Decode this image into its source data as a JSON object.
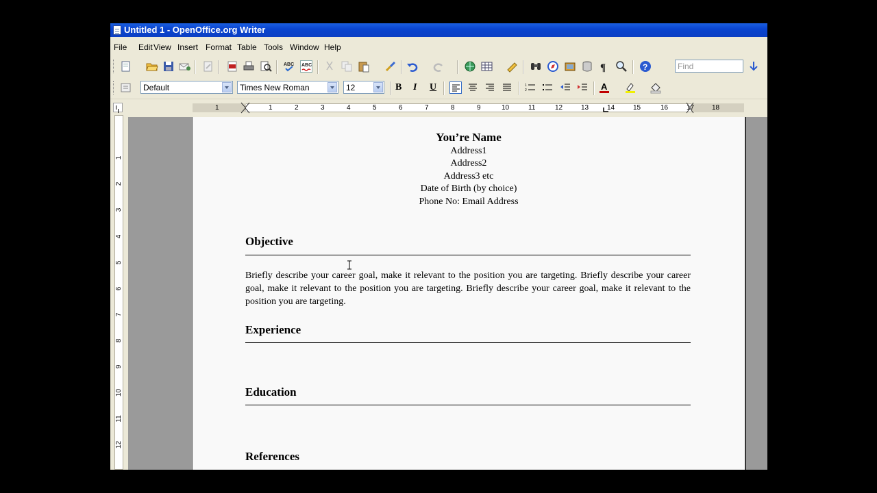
{
  "window": {
    "title": "Untitled 1 - OpenOffice.org Writer"
  },
  "menu": [
    "File",
    "Edit",
    "View",
    "Insert",
    "Format",
    "Table",
    "Tools",
    "Window",
    "Help"
  ],
  "toolbar_standard": {
    "icons": [
      "new-document-icon",
      "open-folder-icon",
      "save-icon",
      "email-icon",
      "edit-file-icon",
      "export-pdf-icon",
      "print-icon",
      "page-preview-icon",
      "spellcheck-icon",
      "autospellcheck-icon",
      "cut-icon",
      "copy-icon",
      "paste-icon",
      "format-paintbrush-icon",
      "undo-icon",
      "redo-icon",
      "hyperlink-icon",
      "table-icon",
      "draw-functions-icon",
      "find-replace-icon",
      "navigator-icon",
      "gallery-icon",
      "data-sources-icon",
      "nonprinting-characters-icon",
      "zoom-icon",
      "help-icon"
    ],
    "find_placeholder": "Find"
  },
  "toolbar_formatting": {
    "style": "Default",
    "font": "Times New Roman",
    "size": "12",
    "bold": "B",
    "italic": "I",
    "underline": "U"
  },
  "ruler": {
    "h_numbers": [
      "1",
      "1",
      "2",
      "3",
      "4",
      "5",
      "6",
      "7",
      "8",
      "9",
      "10",
      "11",
      "12",
      "13",
      "14",
      "15",
      "16",
      "17",
      "18"
    ],
    "v_numbers": [
      "1",
      "2",
      "3",
      "4",
      "5",
      "6",
      "7",
      "8",
      "9",
      "10",
      "11",
      "12"
    ]
  },
  "document": {
    "name": "You’re Name",
    "address_lines": [
      "Address1",
      "Address2",
      "Address3 etc",
      "Date of Birth (by choice)",
      "Phone No: Email Address"
    ],
    "sections": {
      "objective": "Objective",
      "objective_text": "Briefly describe your career goal, make it relevant to the position you are targeting. Briefly describe your career goal, make it relevant to the position you are targeting. Briefly describe your career goal, make it relevant to the position you are targeting.",
      "experience": "Experience",
      "education": "Education",
      "references": "References"
    }
  }
}
